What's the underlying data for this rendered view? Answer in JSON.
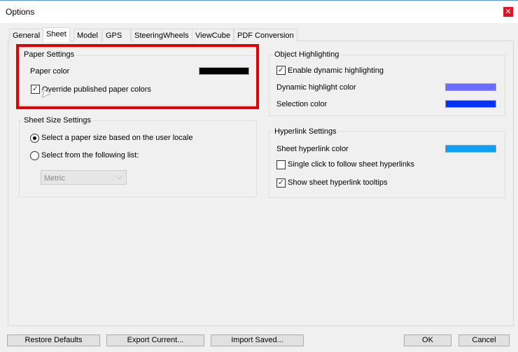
{
  "window": {
    "title": "Options",
    "close_icon": "close-icon"
  },
  "tabs": [
    {
      "label": "General"
    },
    {
      "label": "Sheet"
    },
    {
      "label": "Model"
    },
    {
      "label": "GPS"
    },
    {
      "label": "SteeringWheels"
    },
    {
      "label": "ViewCube"
    },
    {
      "label": "PDF Conversion"
    }
  ],
  "active_tab": "Sheet",
  "paper": {
    "title": "Paper Settings",
    "color_label": "Paper color",
    "color": "#000000",
    "override_label": "Override published paper colors",
    "override_checked": true
  },
  "sheet_size": {
    "title": "Sheet Size Settings",
    "opt1": "Select a paper size based on the user locale",
    "opt2": "Select from the following list:",
    "selected": "opt1",
    "dropdown_value": "Metric"
  },
  "object_highlighting": {
    "title": "Object Highlighting",
    "enable_label": "Enable dynamic highlighting",
    "enable_checked": true,
    "dynamic_label": "Dynamic highlight color",
    "dynamic_color": "#6b6bff",
    "selection_label": "Selection color",
    "selection_color": "#0033ff"
  },
  "hyperlink": {
    "title": "Hyperlink Settings",
    "color_label": "Sheet hyperlink color",
    "color": "#0fa0f5",
    "single_click_label": "Single click to follow sheet hyperlinks",
    "single_click_checked": false,
    "tooltips_label": "Show sheet hyperlink tooltips",
    "tooltips_checked": true
  },
  "buttons": {
    "restore": "Restore Defaults",
    "export": "Export Current...",
    "import": "Import Saved...",
    "ok": "OK",
    "cancel": "Cancel"
  },
  "accent": {
    "annotation": "#e20000"
  }
}
